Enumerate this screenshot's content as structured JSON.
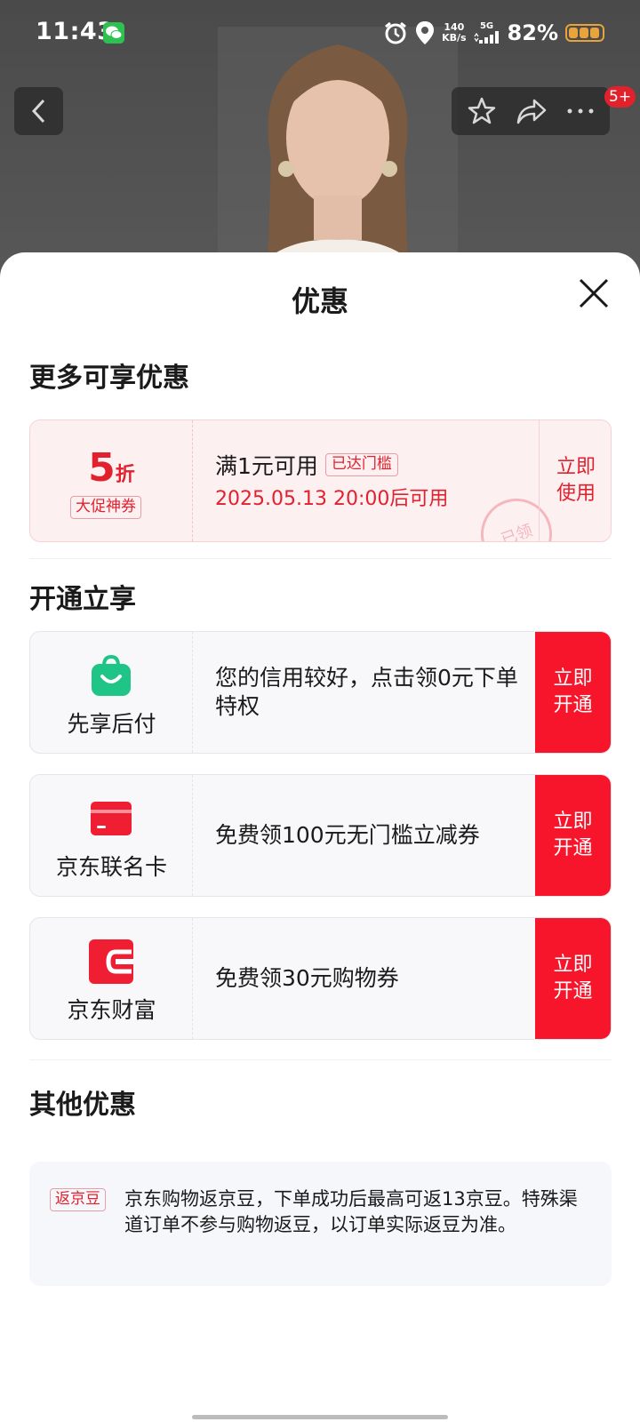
{
  "status_bar": {
    "time": "11:43",
    "speed_value": "140",
    "speed_unit": "KB/s",
    "network": "5G",
    "battery": "82%"
  },
  "header": {
    "cart_badge": "5+"
  },
  "sheet": {
    "title": "优惠",
    "more_offers": {
      "title": "更多可享优惠",
      "coupon": {
        "value": "5",
        "unit": "折",
        "tag": "大促神券",
        "condition": "满1元可用",
        "reached": "已达门槛",
        "valid_time": "2025.05.13 20:00后可用",
        "stamp": "已领",
        "use_label_1": "立即",
        "use_label_2": "使用"
      }
    },
    "activate": {
      "title": "开通立享",
      "items": [
        {
          "name": "先享后付",
          "desc": "您的信用较好，点击领0元下单特权",
          "btn_1": "立即",
          "btn_2": "开通"
        },
        {
          "name": "京东联名卡",
          "desc": "免费领100元无门槛立减券",
          "btn_1": "立即",
          "btn_2": "开通"
        },
        {
          "name": "京东财富",
          "desc": "免费领30元购物券",
          "btn_1": "立即",
          "btn_2": "开通"
        }
      ]
    },
    "other": {
      "title": "其他优惠",
      "tag": "返京豆",
      "text": "京东购物返京豆，下单成功后最高可返13京豆。特殊渠道订单不参与购物返豆，以订单实际返豆为准。"
    }
  },
  "colors": {
    "accent": "#f7152b",
    "coupon_red": "#e1212e",
    "coupon_bg": "#fdf0f1",
    "card_bg": "#f8f8fa"
  }
}
